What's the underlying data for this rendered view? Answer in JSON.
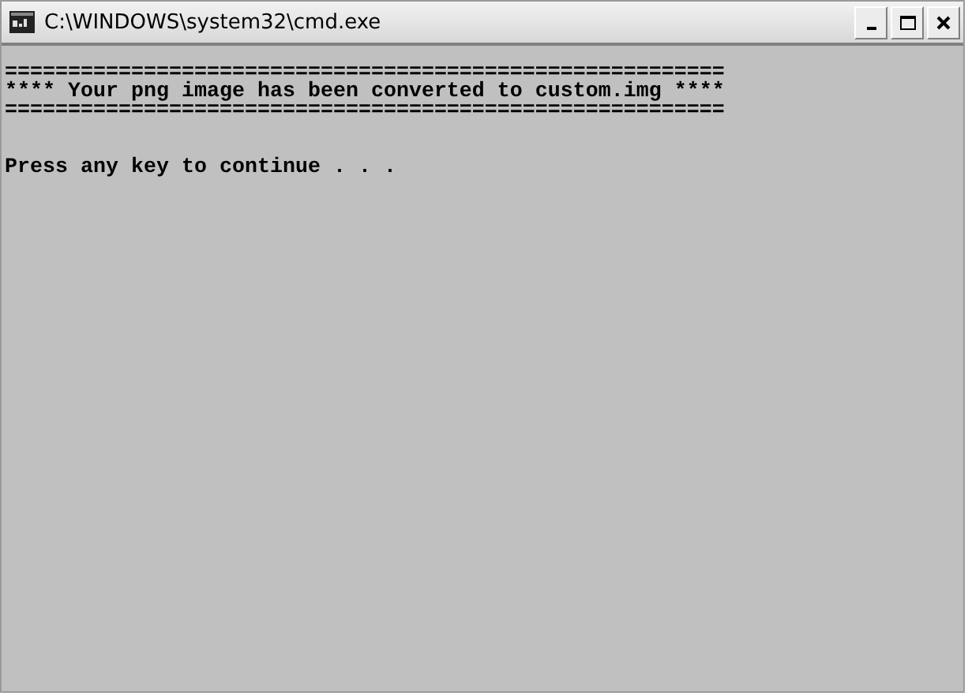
{
  "window": {
    "title": "C:\\WINDOWS\\system32\\cmd.exe"
  },
  "console": {
    "lines": [
      {
        "kind": "rule",
        "text": "========================================================="
      },
      {
        "kind": "message",
        "text": "**** Your png image has been converted to custom.img ****"
      },
      {
        "kind": "rule",
        "text": "========================================================="
      },
      {
        "kind": "prompt",
        "text": "Press any key to continue . . ."
      }
    ]
  }
}
